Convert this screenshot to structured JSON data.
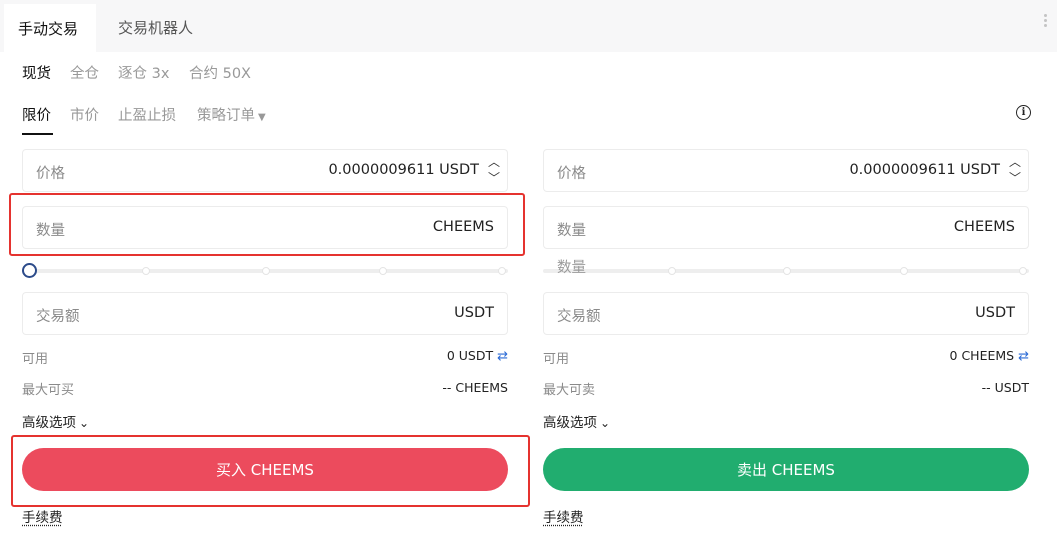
{
  "tabs": {
    "manual": "手动交易",
    "bot": "交易机器人"
  },
  "modes": [
    "现货",
    "全仓",
    "逐仓 3x",
    "合约 50X"
  ],
  "order_types": [
    "限价",
    "市价",
    "止盈止损",
    "策略订单"
  ],
  "icons": {
    "info": "info-icon",
    "more": "kebab-icon",
    "swap": "swap-icon",
    "stepper": "stepper-icon",
    "dropdown": "chevron-down-icon"
  },
  "buy": {
    "price_label": "价格",
    "price_value": "0.0000009611 USDT",
    "qty_label": "数量",
    "qty_unit": "CHEEMS",
    "amount_label": "交易额",
    "amount_unit": "USDT",
    "available_label": "可用",
    "available_value": "0 USDT",
    "max_label": "最大可买",
    "max_value": "-- CHEEMS",
    "advanced": "高级选项",
    "button": "买入 CHEEMS",
    "fee": "手续费",
    "slider_value": 0
  },
  "sell": {
    "price_label": "价格",
    "price_value": "0.0000009611 USDT",
    "qty_label": "数量",
    "qty_unit": "CHEEMS",
    "slider_tooltip": "数量",
    "amount_label": "交易额",
    "amount_unit": "USDT",
    "available_label": "可用",
    "available_value": "0 CHEEMS",
    "max_label": "最大可卖",
    "max_value": "-- USDT",
    "advanced": "高级选项",
    "button": "卖出 CHEEMS",
    "fee": "手续费"
  },
  "colors": {
    "buy": "#ec4b5d",
    "sell": "#21ad6f",
    "highlight": "#e5332f",
    "knob": "#2c4b8a"
  }
}
